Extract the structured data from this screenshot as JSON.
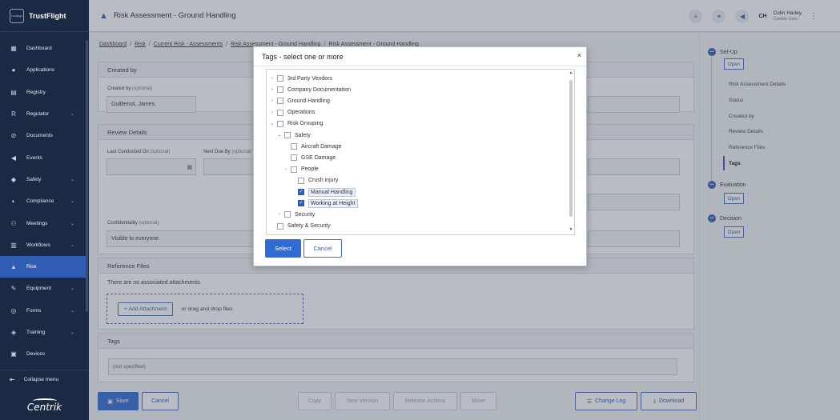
{
  "app": {
    "brand": "TrustFlight",
    "logo_small": "TrustFlight"
  },
  "sidebar": {
    "items": [
      {
        "label": "Dashboard",
        "icon": "dashboard-icon",
        "chevron": false
      },
      {
        "label": "Applications",
        "icon": "applications-icon",
        "chevron": false
      },
      {
        "label": "Registry",
        "icon": "registry-icon",
        "chevron": false
      },
      {
        "label": "Regulator",
        "icon": "regulator-icon",
        "chevron": true
      },
      {
        "label": "Documents",
        "icon": "documents-icon",
        "chevron": false
      },
      {
        "label": "Events",
        "icon": "events-icon",
        "chevron": false
      },
      {
        "label": "Safety",
        "icon": "safety-icon",
        "chevron": true
      },
      {
        "label": "Compliance",
        "icon": "compliance-icon",
        "chevron": true
      },
      {
        "label": "Meetings",
        "icon": "meetings-icon",
        "chevron": true
      },
      {
        "label": "Workflows",
        "icon": "workflows-icon",
        "chevron": true
      },
      {
        "label": "Risk",
        "icon": "risk-icon",
        "chevron": false,
        "active": true
      },
      {
        "label": "Equipment",
        "icon": "equipment-icon",
        "chevron": true
      },
      {
        "label": "Forms",
        "icon": "forms-icon",
        "chevron": true
      },
      {
        "label": "Training",
        "icon": "training-icon",
        "chevron": true
      },
      {
        "label": "Devices",
        "icon": "devices-icon",
        "chevron": false
      }
    ],
    "collapse_label": "Collapse menu",
    "footer_brand": "Centrik"
  },
  "header": {
    "title": "Risk Assessment - Ground Handling",
    "initials": "CH",
    "user_name": "Colin Harley",
    "user_role": "Centrik User"
  },
  "breadcrumb": [
    "Dashboard",
    "Risk",
    "Current Risk - Assessments",
    "Risk Assessment - Ground Handling",
    "Risk Assessment - Ground Handling"
  ],
  "created_by": {
    "title": "Created by",
    "field_label": "Created by",
    "optional": "(optional)",
    "value": "Guillemot, James"
  },
  "review": {
    "title": "Review Details",
    "last_conducted_label": "Last Conducted On",
    "next_due_label": "Next Due By",
    "optional": "(optional)",
    "confidentiality_label": "Confidentiality",
    "confidentiality_value": "Visible to everyone"
  },
  "reference_files": {
    "title": "Reference Files",
    "empty_text": "There are no associated attachments.",
    "add_label": "+ Add Attachment",
    "drag_text": "or drag and drop files"
  },
  "tags": {
    "title": "Tags",
    "value": "(not specified)"
  },
  "footer": {
    "save": "Save",
    "cancel": "Cancel",
    "copy": "Copy",
    "new_version": "New Version",
    "release_actions": "Release Actions",
    "move": "Move",
    "change_log": "Change Log",
    "download": "Download"
  },
  "right_panel": {
    "setup": "Set-Up",
    "open": "Open",
    "sub_items": [
      "Risk Assessment Details",
      "Status",
      "Created by",
      "Review Details",
      "Reference Files",
      "Tags"
    ],
    "active_sub": "Tags",
    "evaluation": "Evaluation",
    "decision": "Decision"
  },
  "modal": {
    "title": "Tags - select one or more",
    "close": "×",
    "tree": [
      {
        "label": "3rd Party Vendors",
        "level": 0,
        "expander": "›",
        "checked": false
      },
      {
        "label": "Company Documentation",
        "level": 0,
        "expander": "›",
        "checked": false
      },
      {
        "label": "Ground Handling",
        "level": 0,
        "expander": "›",
        "checked": false
      },
      {
        "label": "Operations",
        "level": 0,
        "expander": "›",
        "checked": false
      },
      {
        "label": "Risk Grouping",
        "level": 0,
        "expander": "⌄",
        "checked": false
      },
      {
        "label": "Safety",
        "level": 1,
        "expander": "⌄",
        "checked": false
      },
      {
        "label": "Aircraft Damage",
        "level": 2,
        "expander": "",
        "checked": false
      },
      {
        "label": "GSE Damage",
        "level": 2,
        "expander": "",
        "checked": false
      },
      {
        "label": "People",
        "level": 2,
        "expander": "›",
        "checked": false
      },
      {
        "label": "Crush injury",
        "level": 3,
        "expander": "",
        "checked": false
      },
      {
        "label": "Manual Handling",
        "level": 3,
        "expander": "",
        "checked": true
      },
      {
        "label": "Working at Height",
        "level": 3,
        "expander": "",
        "checked": true
      },
      {
        "label": "Security",
        "level": 1,
        "expander": "›",
        "checked": false
      },
      {
        "label": "Safety & Security",
        "level": 0,
        "expander": "",
        "checked": false
      }
    ],
    "select": "Select",
    "cancel": "Cancel"
  }
}
